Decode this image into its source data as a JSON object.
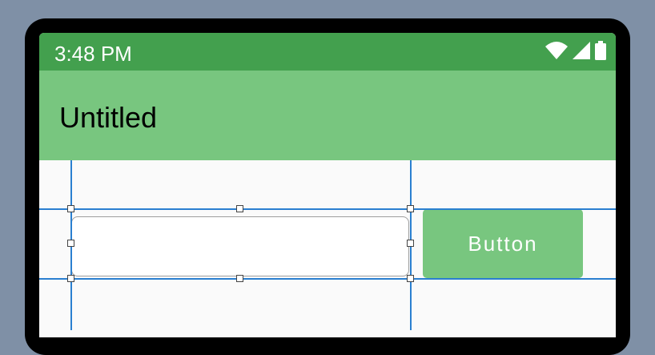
{
  "status_bar": {
    "time": "3:48 PM",
    "icons": [
      "wifi-icon",
      "cellular-icon",
      "battery-icon"
    ]
  },
  "app_bar": {
    "title": "Untitled"
  },
  "content": {
    "text_field_value": "",
    "button_label": "Button"
  },
  "colors": {
    "status_bar": "#43a04e",
    "app_bar": "#78c67f",
    "button": "#78c67f",
    "guides": "#2a7fd0",
    "background": "#7f90a6"
  }
}
